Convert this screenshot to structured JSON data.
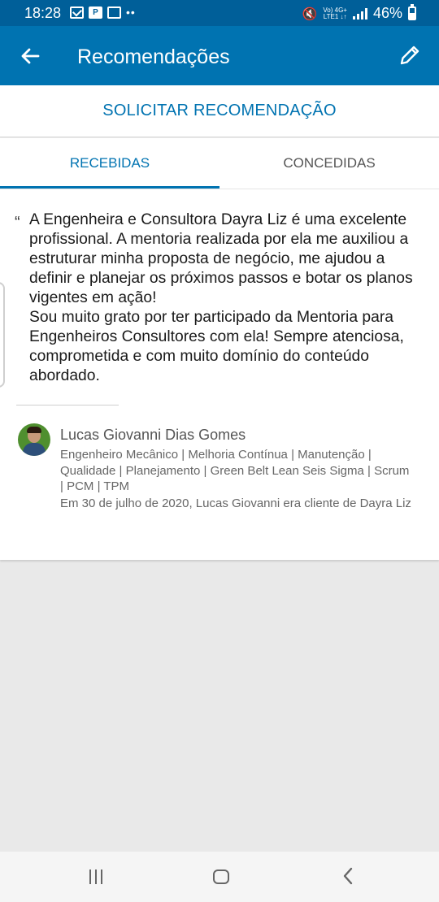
{
  "status_bar": {
    "time": "18:28",
    "network_top": "Vo) 4G+",
    "network_bottom": "LTE1 ↓↑",
    "battery": "46%"
  },
  "app_bar": {
    "title": "Recomendações",
    "back_icon": "arrow-left-icon",
    "edit_icon": "pencil-icon"
  },
  "request": {
    "label": "SOLICITAR RECOMENDAÇÃO"
  },
  "tabs": [
    {
      "label": "RECEBIDAS",
      "active": true
    },
    {
      "label": "CONCEDIDAS",
      "active": false
    }
  ],
  "recommendation": {
    "quote_mark": "“",
    "paragraphs": [
      "A Engenheira e Consultora Dayra Liz é uma excelente profissional. A mentoria realizada por ela me auxiliou a estruturar minha proposta de negócio, me ajudou a definir e planejar os próximos passos e botar os planos vigentes em ação!",
      "Sou muito grato por ter participado da Mentoria para Engenheiros Consultores com ela! Sempre atenciosa, comprometida e com muito domínio do conteúdo abordado."
    ],
    "author": {
      "name": "Lucas Giovanni Dias Gomes",
      "headline": "Engenheiro Mecânico | Melhoria Contínua | Manutenção | Qualidade | Planejamento | Green Belt Lean Seis Sigma | Scrum | PCM | TPM",
      "relation": "Em 30 de julho de 2020, Lucas Giovanni era cliente de Dayra Liz"
    }
  },
  "colors": {
    "primary": "#0073b1",
    "status_bar": "#005f99",
    "background": "#e9e9e9"
  }
}
